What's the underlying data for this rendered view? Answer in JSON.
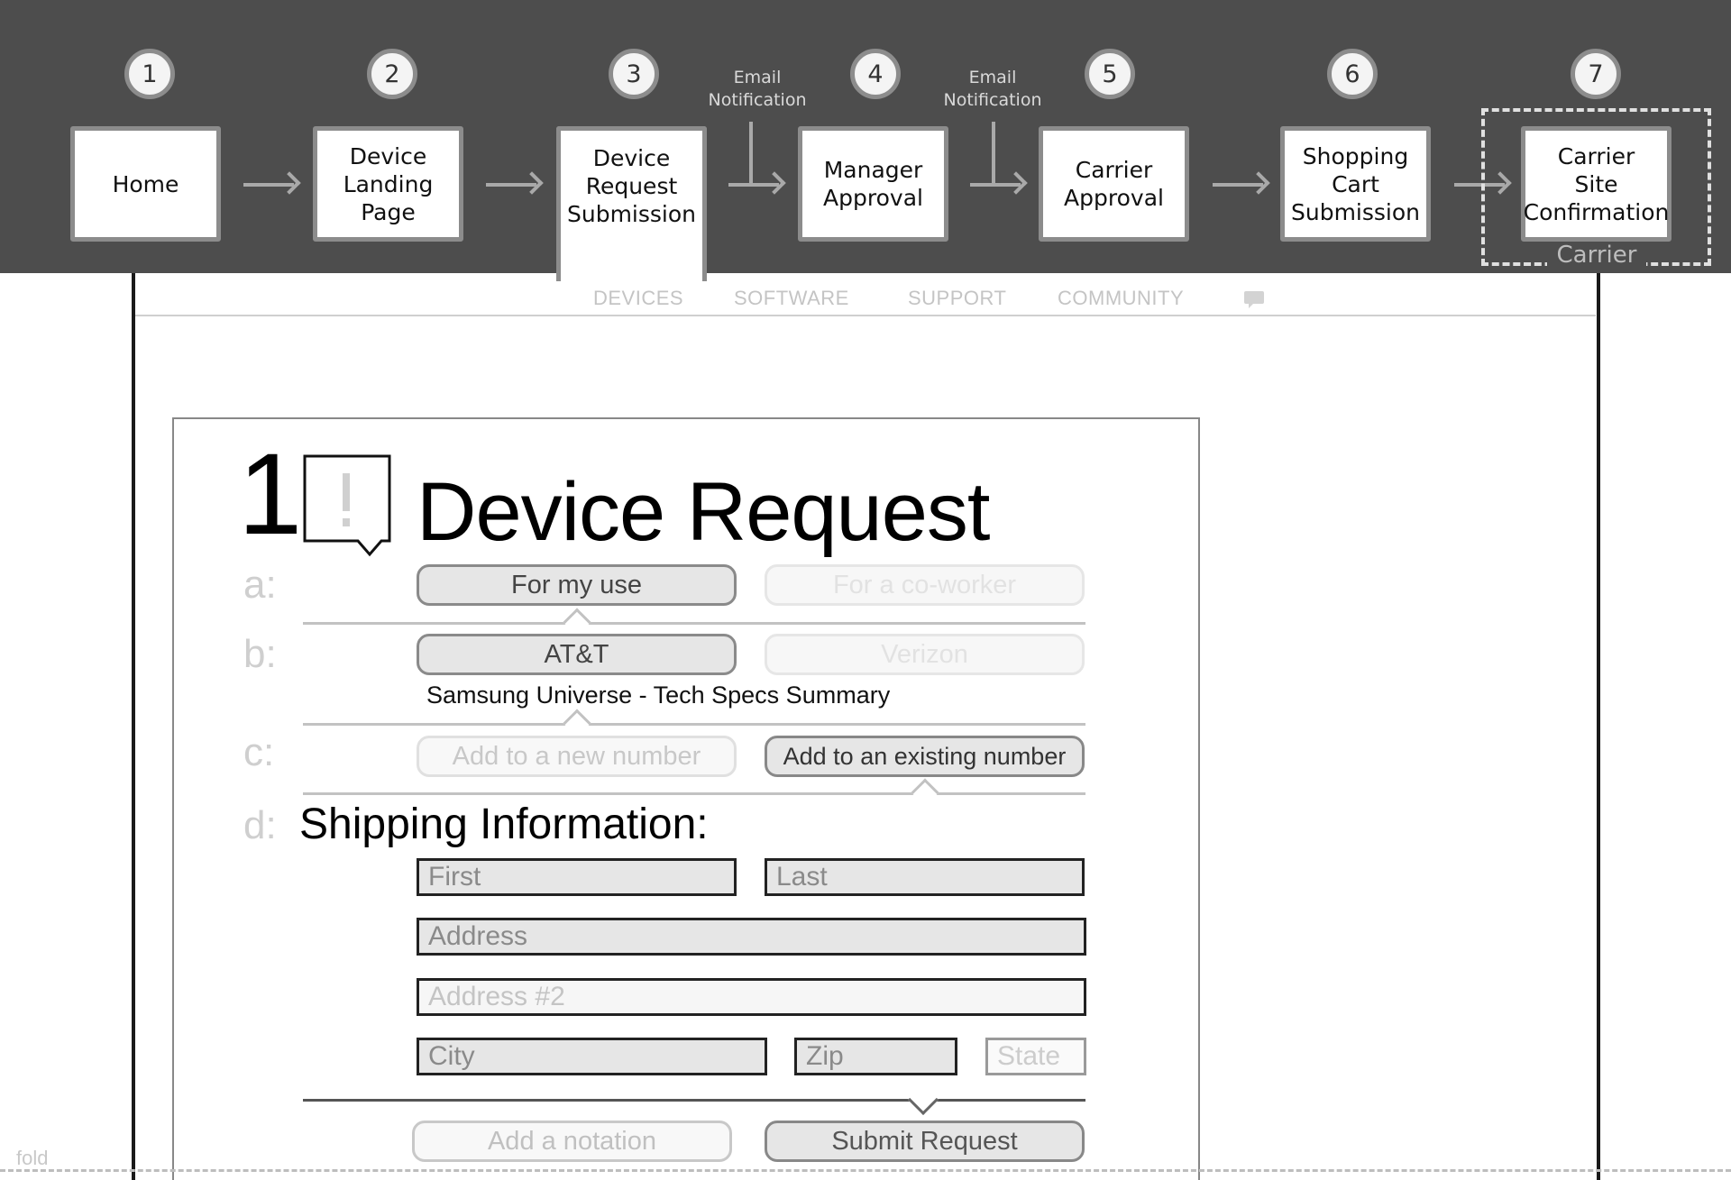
{
  "flow": {
    "steps": [
      {
        "num": "1",
        "label": "Home"
      },
      {
        "num": "2",
        "label": "Device\nLanding\nPage"
      },
      {
        "num": "3",
        "label": "Device\nRequest\nSubmission"
      },
      {
        "num": "4",
        "label": "Manager\nApproval"
      },
      {
        "num": "5",
        "label": "Carrier\nApproval"
      },
      {
        "num": "6",
        "label": "Shopping\nCart\nSubmission"
      },
      {
        "num": "7",
        "label": "Carrier\nSite\nConfirmation"
      }
    ],
    "notifications": [
      "Email\nNotification",
      "Email\nNotification"
    ],
    "carrier_group_label": "Carrier"
  },
  "nav": {
    "items": [
      "DEVICES",
      "SOFTWARE",
      "SUPPORT",
      "COMMUNITY"
    ]
  },
  "form": {
    "step_number": "1",
    "title": "Device Request",
    "rows": {
      "a": {
        "letter": "a:",
        "options": [
          "For my use",
          "For a co-worker"
        ]
      },
      "b": {
        "letter": "b:",
        "options": [
          "AT&T",
          "Verizon"
        ],
        "product": "Samsung Universe - Tech Specs Summary"
      },
      "c": {
        "letter": "c:",
        "options": [
          "Add to a new number",
          "Add to an existing number"
        ]
      },
      "d": {
        "letter": "d:",
        "title": "Shipping Information:"
      }
    },
    "fields": {
      "first": "First",
      "last": "Last",
      "address": "Address",
      "address2": "Address #2",
      "city": "City",
      "zip": "Zip",
      "state": "State"
    },
    "actions": {
      "notation": "Add a notation",
      "submit": "Submit Request"
    }
  },
  "fold_label": "fold"
}
